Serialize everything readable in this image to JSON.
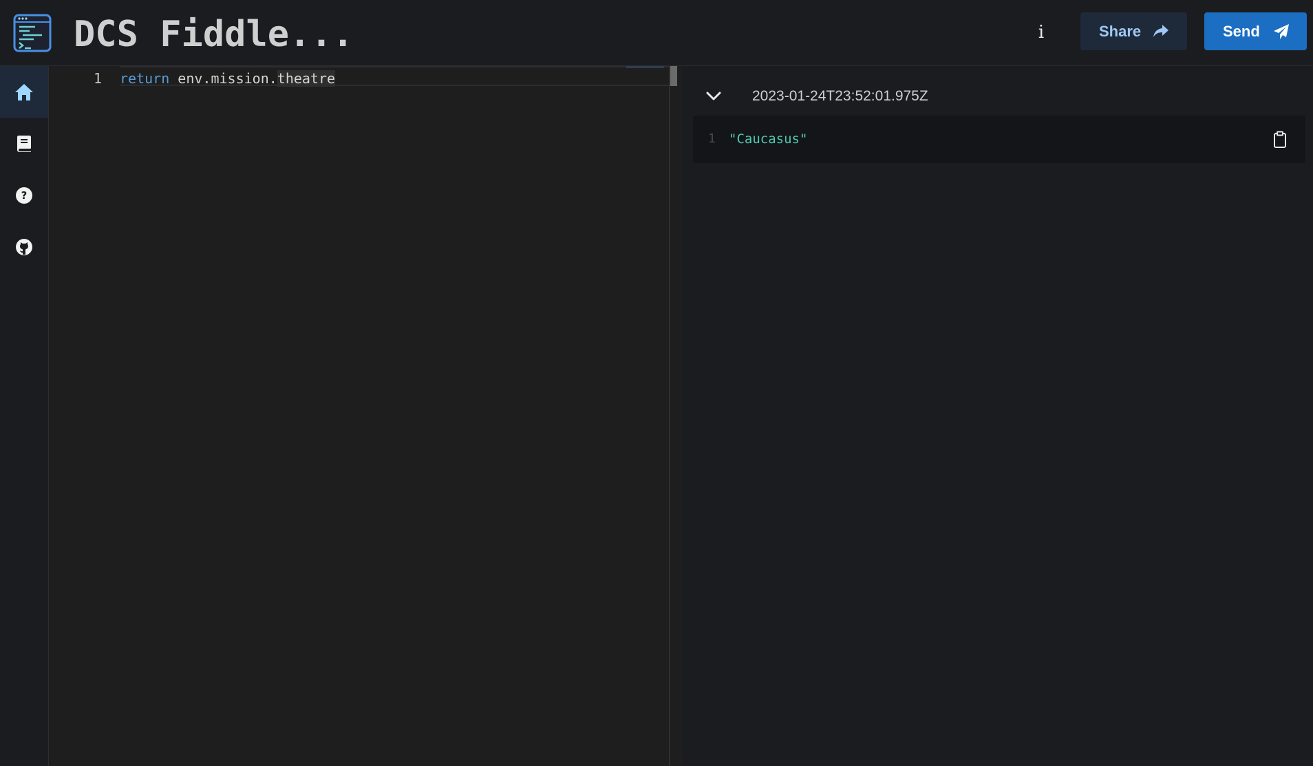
{
  "header": {
    "title": "DCS Fiddle...",
    "info_label": "i",
    "share_label": "Share",
    "send_label": "Send"
  },
  "sidebar": {
    "items": [
      {
        "name": "home",
        "icon": "home-icon",
        "active": true
      },
      {
        "name": "docs",
        "icon": "book-icon",
        "active": false
      },
      {
        "name": "help",
        "icon": "question-circle-icon",
        "active": false
      },
      {
        "name": "github",
        "icon": "github-icon",
        "active": false
      }
    ]
  },
  "editor": {
    "line_number": "1",
    "code": {
      "keyword": "return",
      "space": " ",
      "plain": "env.mission.",
      "highlight": "theatre"
    }
  },
  "output": {
    "results": [
      {
        "timestamp": "2023-01-24T23:52:01.975Z",
        "line_number": "1",
        "value": "\"Caucasus\""
      }
    ]
  },
  "colors": {
    "accent": "#1b6ec2",
    "share_bg": "#1e2a3a",
    "keyword": "#569cd6",
    "string": "#4ec9b0"
  }
}
